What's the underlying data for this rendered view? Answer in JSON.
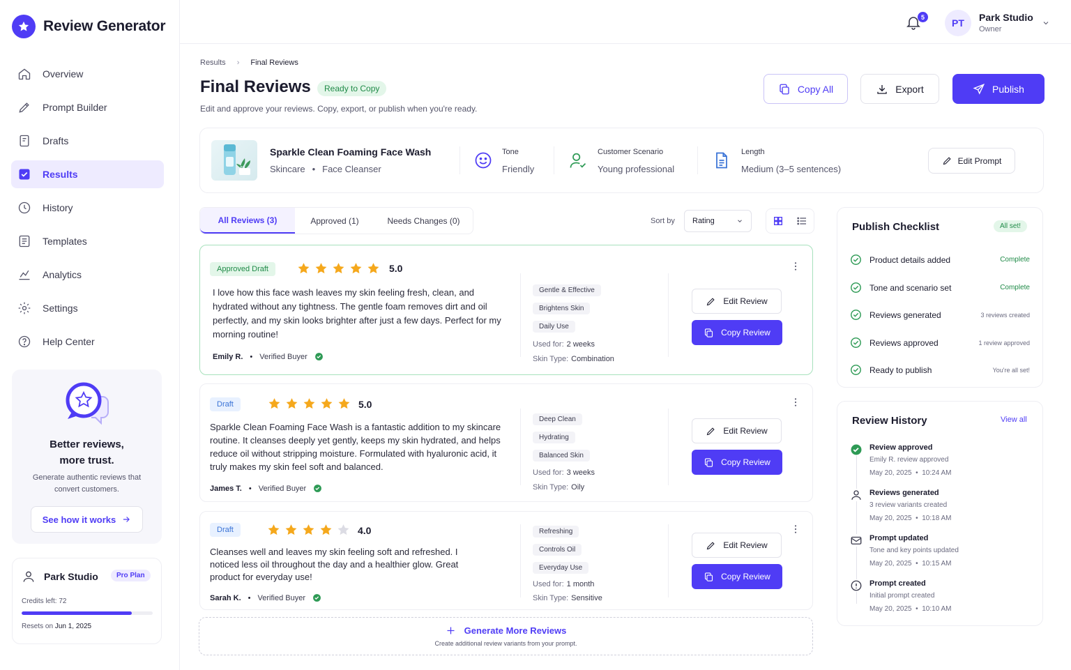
{
  "app": {
    "name": "Review Generator"
  },
  "sidebar": {
    "items": [
      {
        "label": "Overview"
      },
      {
        "label": "Prompt Builder"
      },
      {
        "label": "Drafts"
      },
      {
        "label": "Results"
      },
      {
        "label": "History"
      },
      {
        "label": "Templates"
      },
      {
        "label": "Analytics"
      },
      {
        "label": "Settings"
      },
      {
        "label": "Help Center"
      }
    ],
    "promo": {
      "title": "Better reviews, more trust.",
      "subtitle": "Generate authentic reviews that convert customers.",
      "cta": "See how it works"
    },
    "account": {
      "name": "Park Studio",
      "plan": "Pro Plan",
      "credits": "Credits left:  72",
      "credits_fraction": 0.84,
      "resets_label": "Resets on",
      "resets_date": "Jun 1, 2025"
    }
  },
  "topbar": {
    "notifications": "5",
    "initials": "PT",
    "user_name": "Park Studio",
    "user_role": "Owner"
  },
  "header": {
    "breadcrumb": [
      "Results",
      "Final Reviews"
    ],
    "title": "Final Reviews",
    "badge": "Ready to Copy",
    "subtitle": "Edit and approve your reviews. Copy, export, or publish when you're ready.",
    "copy_all": "Copy All",
    "export": "Export",
    "publish": "Publish"
  },
  "product": {
    "name": "Sparkle Clean Foaming Face Wash",
    "category": "Skincare",
    "subcategory": "Face Cleanser",
    "tone_label": "Tone",
    "tone": "Friendly",
    "scenario_label": "Customer Scenario",
    "scenario": "Young professional",
    "length_label": "Length",
    "length": "Medium (3–5 sentences)",
    "edit_prompt": "Edit Prompt"
  },
  "tabs": [
    {
      "label": "All Reviews (3)"
    },
    {
      "label": "Approved (1)"
    },
    {
      "label": "Needs Changes (0)"
    }
  ],
  "sort": {
    "label": "Sort by",
    "value": "Rating"
  },
  "reviews": [
    {
      "status": "Approved Draft",
      "rating": 5,
      "rating_text": "5.0",
      "text": "I love how this face wash leaves my skin feeling fresh, clean, and hydrated without any tightness. The gentle foam removes dirt and oil perfectly, and my skin looks brighter after just a few days. Perfect for my morning routine!",
      "author": "Emily R.",
      "verified": "Verified Buyer",
      "tags": [
        "Gentle & Effective",
        "Brightens Skin",
        "Daily Use"
      ],
      "used_label": "Used for:",
      "used": "2 weeks",
      "skin_label": "Skin Type:",
      "skin": "Combination",
      "edit": "Edit Review",
      "copy": "Copy Review"
    },
    {
      "status": "Draft",
      "rating": 5,
      "rating_text": "5.0",
      "text": "Sparkle Clean Foaming Face Wash is a fantastic addition to my skincare routine. It cleanses deeply yet gently, keeps my skin hydrated, and helps reduce oil without stripping moisture. Formulated with hyaluronic acid, it truly makes my skin feel soft and balanced.",
      "author": "James T.",
      "verified": "Verified Buyer",
      "tags": [
        "Deep Clean",
        "Hydrating",
        "Balanced Skin"
      ],
      "used_label": "Used for:",
      "used": "3 weeks",
      "skin_label": "Skin Type:",
      "skin": "Oily",
      "edit": "Edit Review",
      "copy": "Copy Review"
    },
    {
      "status": "Draft",
      "rating": 4,
      "rating_text": "4.0",
      "text": "Cleanses well and leaves my skin feeling soft and refreshed. I noticed less oil throughout the day and a healthier glow. Great product for everyday use!",
      "author": "Sarah K.",
      "verified": "Verified Buyer",
      "tags": [
        "Refreshing",
        "Controls Oil",
        "Everyday Use"
      ],
      "used_label": "Used for:",
      "used": "1 month",
      "skin_label": "Skin Type:",
      "skin": "Sensitive",
      "edit": "Edit Review",
      "copy": "Copy Review"
    }
  ],
  "generate_more": {
    "title": "Generate More Reviews",
    "subtitle": "Create additional review variants from your prompt."
  },
  "checklist": {
    "title": "Publish Checklist",
    "badge": "All set!",
    "items": [
      {
        "label": "Product details added",
        "status": "Complete"
      },
      {
        "label": "Tone and scenario set",
        "status": "Complete"
      },
      {
        "label": "Reviews generated",
        "status": "3 reviews created"
      },
      {
        "label": "Reviews approved",
        "status": "1 review approved"
      },
      {
        "label": "Ready to publish",
        "status": "You're all set!"
      }
    ]
  },
  "history": {
    "title": "Review History",
    "view_all": "View all",
    "items": [
      {
        "title": "Review approved",
        "desc": "Emily R. review approved",
        "date": "May 20, 2025",
        "time": "10:24 AM"
      },
      {
        "title": "Reviews generated",
        "desc": "3 review variants created",
        "date": "May 20, 2025",
        "time": "10:18 AM"
      },
      {
        "title": "Prompt updated",
        "desc": "Tone and key points updated",
        "date": "May 20, 2025",
        "time": "10:15 AM"
      },
      {
        "title": "Prompt created",
        "desc": "Initial prompt created",
        "date": "May 20, 2025",
        "time": "10:10 AM"
      }
    ]
  },
  "colors": {
    "accent": "#4f3cf5",
    "success": "#1f8a47",
    "star": "#f5a81c"
  }
}
